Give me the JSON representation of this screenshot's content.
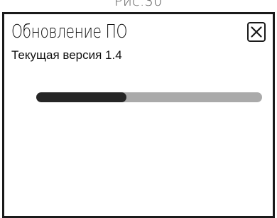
{
  "figure": {
    "caption": "Рис.30"
  },
  "dialog": {
    "title": "Обновление ПО",
    "subtitle": "Текущая версия 1.4",
    "close_icon": "close-icon",
    "progress": 0.4,
    "colors": {
      "progress_fill": "#262626",
      "progress_track": "#aaaaaa",
      "frame": "#1a1a1a"
    }
  }
}
